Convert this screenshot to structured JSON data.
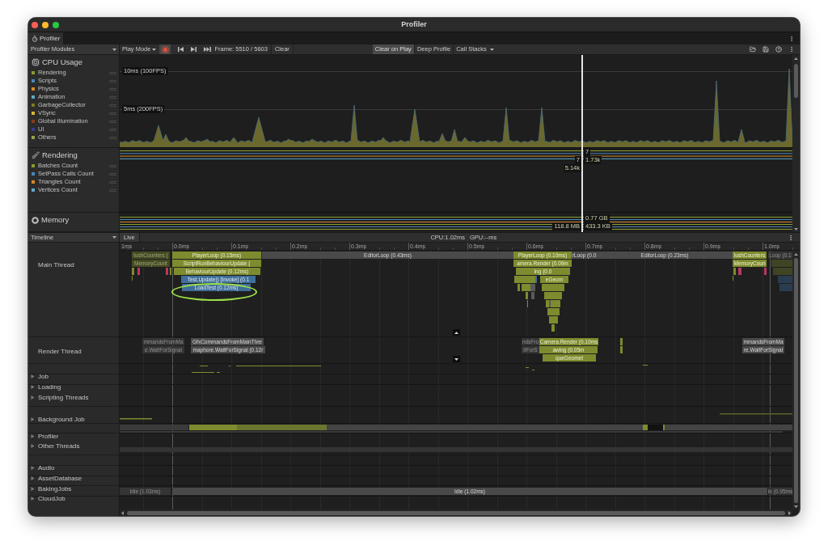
{
  "window": {
    "title": "Profiler"
  },
  "tabs": [
    {
      "label": "Profiler",
      "selected": true
    }
  ],
  "toolbar": {
    "modules_dropdown": "Profiler Modules",
    "target_dropdown": "Play Mode",
    "recording": true,
    "frame": "Frame: 5510 / 5603",
    "clear": "Clear",
    "toggles": [
      {
        "label": "Clear on Play",
        "on": true
      },
      {
        "label": "Deep Profile",
        "on": false
      }
    ],
    "call_stacks": "Call Stacks"
  },
  "modules": [
    {
      "kind": "cpu",
      "title": "CPU Usage",
      "items": [
        {
          "label": "Rendering",
          "color": "#8a9b2f"
        },
        {
          "label": "Scripts",
          "color": "#4a86b8"
        },
        {
          "label": "Physics",
          "color": "#d58a2a"
        },
        {
          "label": "Animation",
          "color": "#5fa8c8"
        },
        {
          "label": "GarbageCollector",
          "color": "#7a7a25"
        },
        {
          "label": "VSync",
          "color": "#d6b832"
        },
        {
          "label": "Global Illumination",
          "color": "#8a3c14"
        },
        {
          "label": "UI",
          "color": "#3b3a8c"
        },
        {
          "label": "Others",
          "color": "#9aa04a"
        }
      ],
      "thresholds": [
        "10ms (100FPS)",
        "5ms (200FPS)"
      ]
    },
    {
      "kind": "rendering",
      "title": "Rendering",
      "items": [
        {
          "label": "Batches Count",
          "color": "#8a9b2f"
        },
        {
          "label": "SetPass Calls Count",
          "color": "#4a86b8"
        },
        {
          "label": "Triangles Count",
          "color": "#d58a2a"
        },
        {
          "label": "Vertices Count",
          "color": "#5fa8c8"
        }
      ]
    },
    {
      "kind": "memory",
      "title": "Memory"
    }
  ],
  "frame_readouts": [
    "7",
    "7",
    "1.73k",
    "5.14k",
    "0.77 GB",
    "118.8 MB",
    "433.3 KB"
  ],
  "timeline": {
    "view_dropdown": "Timeline",
    "live": "Live",
    "cpu": "CPU:1.02ms",
    "gpu": "GPU:--ms",
    "ruler": [
      "1ms",
      "0.0ms",
      "0.1ms",
      "0.2ms",
      "0.3ms",
      "0.4ms",
      "0.5ms",
      "0.6ms",
      "0.7ms",
      "0.8ms",
      "0.9ms",
      "1.0ms"
    ],
    "threads": [
      {
        "name": "Main Thread",
        "bars": [
          {
            "label": "lushCounters (",
            "kind": "engine",
            "faded": true
          },
          {
            "label": "PlayerLoop (0.15ms)",
            "kind": "engine",
            "faded": false
          },
          {
            "label": "EditorLoop (0.43ms)",
            "kind": "editor",
            "faded": false
          },
          {
            "label": "PlayerLoop (0.10ms)",
            "kind": "engine",
            "faded": false
          },
          {
            "label": "rLoop (0.0",
            "kind": "editor",
            "faded": false
          },
          {
            "label": "EditorLoop (0.23ms)",
            "kind": "editor",
            "faded": false
          },
          {
            "label": "lushCounters",
            "kind": "engine",
            "faded": false
          },
          {
            "label": "Loop (0.1",
            "kind": "editor",
            "faded": true
          },
          {
            "label": "MemoryCount",
            "kind": "engine",
            "faded": true
          },
          {
            "label": "ScriptRunBehaviourUpdate (",
            "kind": "engine",
            "faded": false
          },
          {
            "label": "amera.Render (0.09m",
            "kind": "engine",
            "faded": false
          },
          {
            "label": "MemoryCoun",
            "kind": "engine",
            "faded": false
          },
          {
            "label": "BehaviourUpdate (0.12ms)",
            "kind": "engine",
            "faded": false
          },
          {
            "label": "ing (0.0",
            "kind": "engine",
            "faded": false
          },
          {
            "label": "Test.Update() [Invoke] (0.1",
            "kind": "script",
            "faded": false
          },
          {
            "label": "eGeom",
            "kind": "engine",
            "faded": false
          },
          {
            "label": "LoadTest (0.12ms)",
            "kind": "script",
            "faded": false
          }
        ]
      },
      {
        "name": "Render Thread",
        "bars": [
          {
            "label": "mmandsFromMa",
            "kind": "editor",
            "faded": true
          },
          {
            "label": "GfxCommandsFromMainThre",
            "kind": "editor",
            "faded": false
          },
          {
            "label": "ndsFro",
            "kind": "editor",
            "faded": true
          },
          {
            "label": "Camera.Render (0.10ms",
            "kind": "engine",
            "faded": false
          },
          {
            "label": "mmandsFromMa",
            "kind": "editor",
            "faded": false
          },
          {
            "label": "e.WaitForSignal",
            "kind": "editor",
            "faded": true
          },
          {
            "label": "maphore.WaitForSignal (0.12r",
            "kind": "editor",
            "faded": false
          },
          {
            "label": "itForS",
            "kind": "editor",
            "faded": true
          },
          {
            "label": "awing (0.05m",
            "kind": "engine",
            "faded": false
          },
          {
            "label": "re.WaitForSignal",
            "kind": "editor",
            "faded": false
          },
          {
            "label": "queGeomet",
            "kind": "engine",
            "faded": false
          }
        ]
      }
    ],
    "groups": [
      {
        "name": "Job",
        "expanded": false
      },
      {
        "name": "Loading",
        "expanded": false
      },
      {
        "name": "Scripting Threads",
        "expanded": false
      },
      {
        "name": "Background Job",
        "expanded": false
      },
      {
        "name": "Profiler",
        "expanded": false
      },
      {
        "name": "Other Threads",
        "expanded": false
      },
      {
        "name": "Audio",
        "expanded": false
      },
      {
        "name": "AssetDatabase",
        "expanded": false
      },
      {
        "name": "BakingJobs",
        "expanded": false
      },
      {
        "name": "CloudJob",
        "expanded": false,
        "bars": [
          {
            "label": "Idle (1.03ms)",
            "kind": "editor",
            "faded": true
          },
          {
            "label": "Idle (1.02ms)",
            "kind": "editor",
            "faded": false
          },
          {
            "label": "le (0.95ms",
            "kind": "editor",
            "faded": true
          }
        ]
      }
    ]
  }
}
